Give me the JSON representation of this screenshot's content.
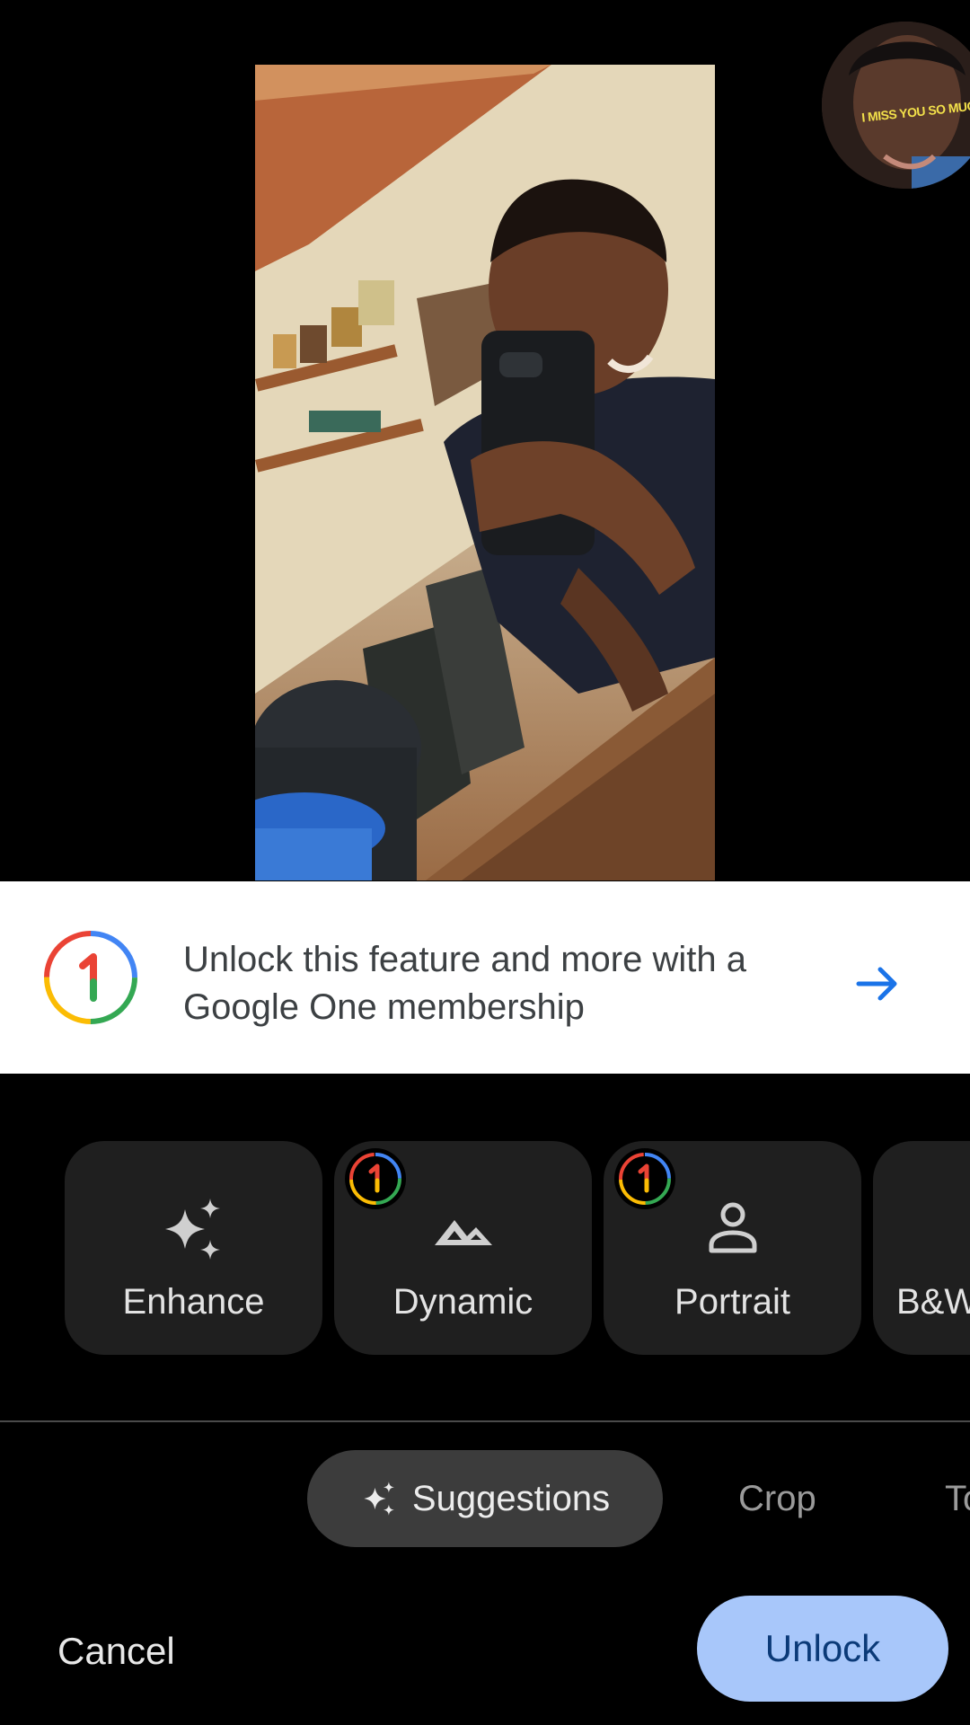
{
  "banner": {
    "text": "Unlock this feature and more with a Google One membership"
  },
  "bubble": {
    "caption": "I MISS YOU SO MUCH"
  },
  "suggestions": [
    {
      "label": "Enhance",
      "icon": "sparkles-icon",
      "premium": false
    },
    {
      "label": "Dynamic",
      "icon": "mountain-icon",
      "premium": true
    },
    {
      "label": "Portrait",
      "icon": "person-icon",
      "premium": true
    },
    {
      "label": "B&W",
      "icon": "bw-icon",
      "premium": false
    }
  ],
  "tabs": {
    "suggestions": "Suggestions",
    "crop": "Crop",
    "tools": "To"
  },
  "actions": {
    "cancel": "Cancel",
    "unlock": "Unlock"
  },
  "colors": {
    "accent": "#1a73e8",
    "unlock_bg": "#a8c7fa",
    "chip_bg": "#1f1f1f"
  }
}
